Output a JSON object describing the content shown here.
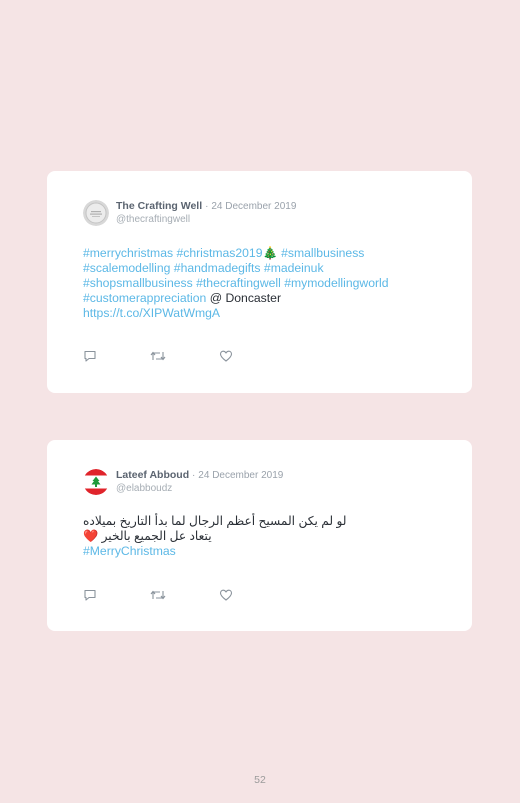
{
  "tweets": [
    {
      "display_name": "The Crafting Well",
      "separator": "·",
      "date": "24 December 2019",
      "handle": "@thecraftingwell",
      "lines": [
        [
          "#merrychristmas",
          " ",
          "#christmas2019",
          "🎄",
          " ",
          "#smallbusiness"
        ],
        [
          "#scalemodelling",
          " ",
          "#handmadegifts",
          " ",
          "#madeinuk"
        ],
        [
          "#shopsmallbusiness",
          " ",
          "#thecraftingwell",
          " ",
          "#mymodellingworld"
        ],
        [
          "#customerappreciation",
          " @ Doncaster"
        ],
        [
          "https://t.co/XIPWatWmgA"
        ]
      ],
      "avatar_icon": "craft-logo-icon"
    },
    {
      "display_name": "Lateef Abboud",
      "separator": "·",
      "date": "24 December 2019",
      "handle": "@elabboudz",
      "lines": [
        [
          "لو لم يكن المسيح أعظم الرجال لما بدأ التاريخ بميلاده"
        ],
        [
          "يتعاد عل الجميع بالخير ",
          "❤️"
        ],
        [
          "#MerryChristmas"
        ]
      ],
      "avatar_icon": "lebanon-flag-icon"
    }
  ],
  "actions": {
    "reply_icon": "reply-icon",
    "retweet_icon": "retweet-icon",
    "like_icon": "heart-icon"
  },
  "page_number": "52",
  "colors": {
    "background": "#f5e4e5",
    "hashtag": "#5cb8e6",
    "text": "#2a2f36"
  }
}
